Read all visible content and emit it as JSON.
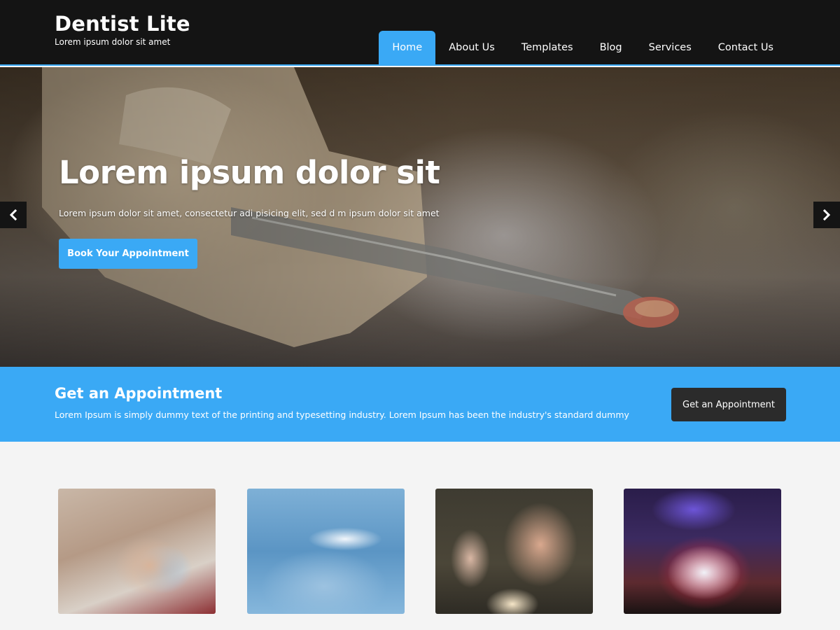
{
  "site": {
    "title": "Dentist Lite",
    "tagline": "Lorem ipsum dolor sit amet"
  },
  "nav": {
    "items": [
      {
        "label": "Home",
        "active": true
      },
      {
        "label": "About Us"
      },
      {
        "label": "Templates"
      },
      {
        "label": "Blog"
      },
      {
        "label": "Services"
      },
      {
        "label": "Contact Us"
      }
    ]
  },
  "hero": {
    "title": "Lorem ipsum dolor sit",
    "subtitle": "Lorem ipsum dolor sit amet, consectetur adi pisicing elit, sed d m ipsum dolor sit amet",
    "button_label": "Book Your Appointment",
    "prev_icon": "chevron-left-icon",
    "next_icon": "chevron-right-icon"
  },
  "cta": {
    "title": "Get an Appointment",
    "text": "Lorem Ipsum is simply dummy text of the printing and typesetting industry. Lorem Ipsum has been the industry's standard dummy",
    "button_label": "Get an Appointment"
  },
  "colors": {
    "accent": "#3aa9f5",
    "header_bg": "#141414",
    "dark_button": "#2b2b2b"
  }
}
